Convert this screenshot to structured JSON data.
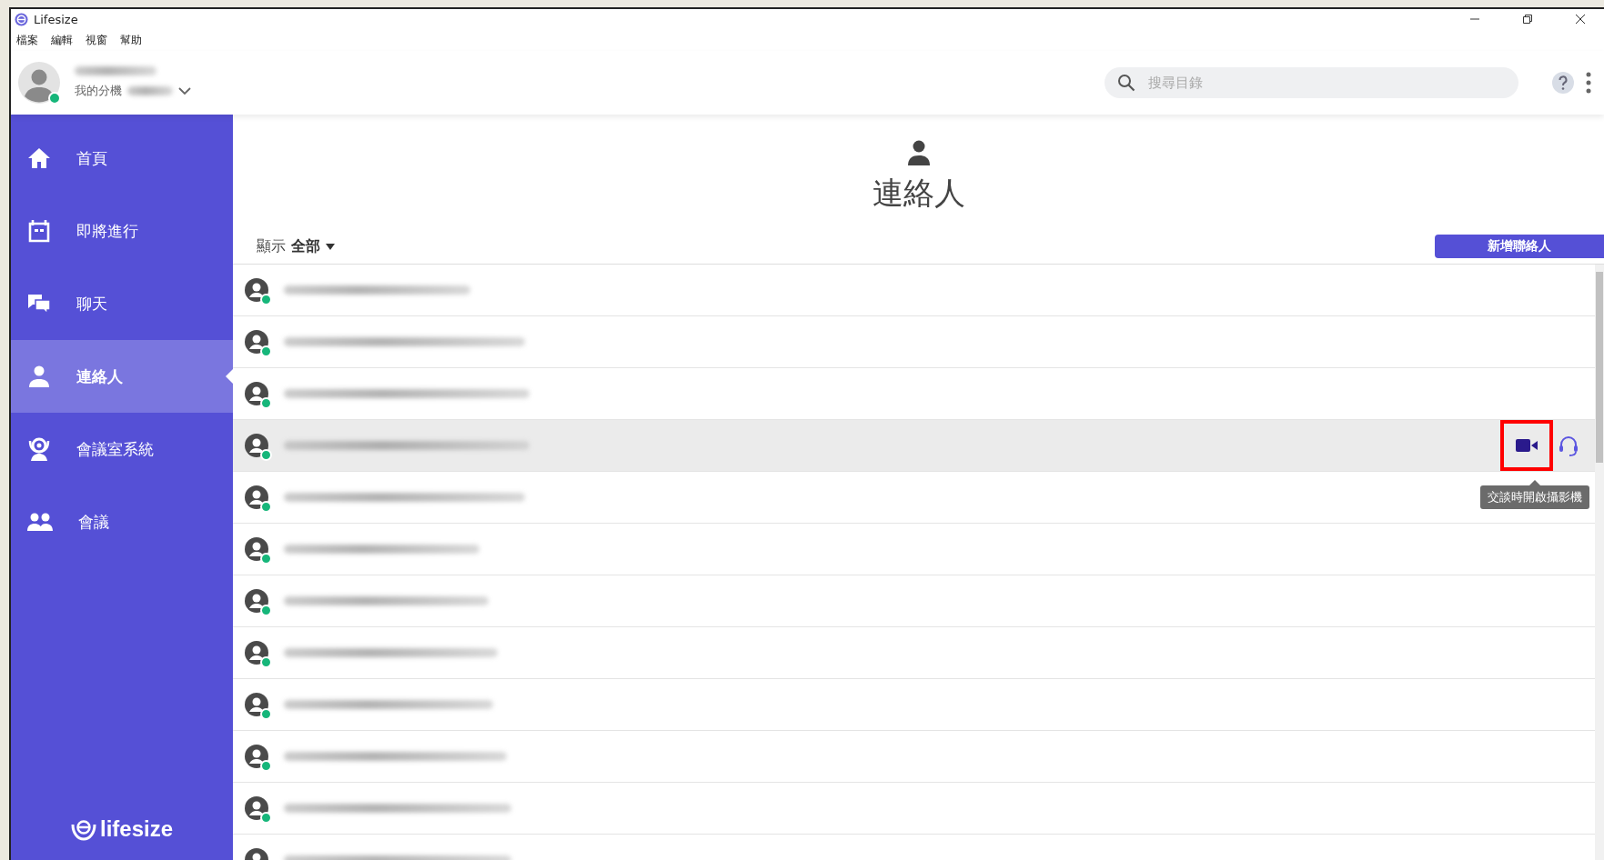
{
  "window": {
    "title": "Lifesize"
  },
  "menu": [
    "檔案",
    "編輯",
    "視窗",
    "幫助"
  ],
  "user": {
    "online": true,
    "extension_label": "我的分機"
  },
  "search": {
    "placeholder": "搜尋目錄"
  },
  "sidebar": {
    "items": [
      {
        "label": "首頁",
        "selected": false
      },
      {
        "label": "即將進行",
        "selected": false
      },
      {
        "label": "聊天",
        "selected": false
      },
      {
        "label": "連絡人",
        "selected": true
      },
      {
        "label": "會議室系統",
        "selected": false
      },
      {
        "label": "會議",
        "selected": false
      }
    ],
    "logo": "lifesize"
  },
  "page": {
    "title": "連絡人",
    "filter_label": "顯示",
    "filter_value": "全部",
    "add_button": "新增聯絡人"
  },
  "contacts": [
    {
      "online": true,
      "hovered": false
    },
    {
      "online": true,
      "hovered": false
    },
    {
      "online": true,
      "hovered": false
    },
    {
      "online": true,
      "hovered": true
    },
    {
      "online": true,
      "hovered": false
    },
    {
      "online": true,
      "hovered": false
    },
    {
      "online": true,
      "hovered": false
    },
    {
      "online": true,
      "hovered": false
    },
    {
      "online": true,
      "hovered": false
    },
    {
      "online": true,
      "hovered": false
    },
    {
      "online": true,
      "hovered": false
    },
    {
      "hovered": false
    }
  ],
  "row_actions": {
    "video_highlighted": true,
    "tooltip": "交談時開啟攝影機"
  }
}
